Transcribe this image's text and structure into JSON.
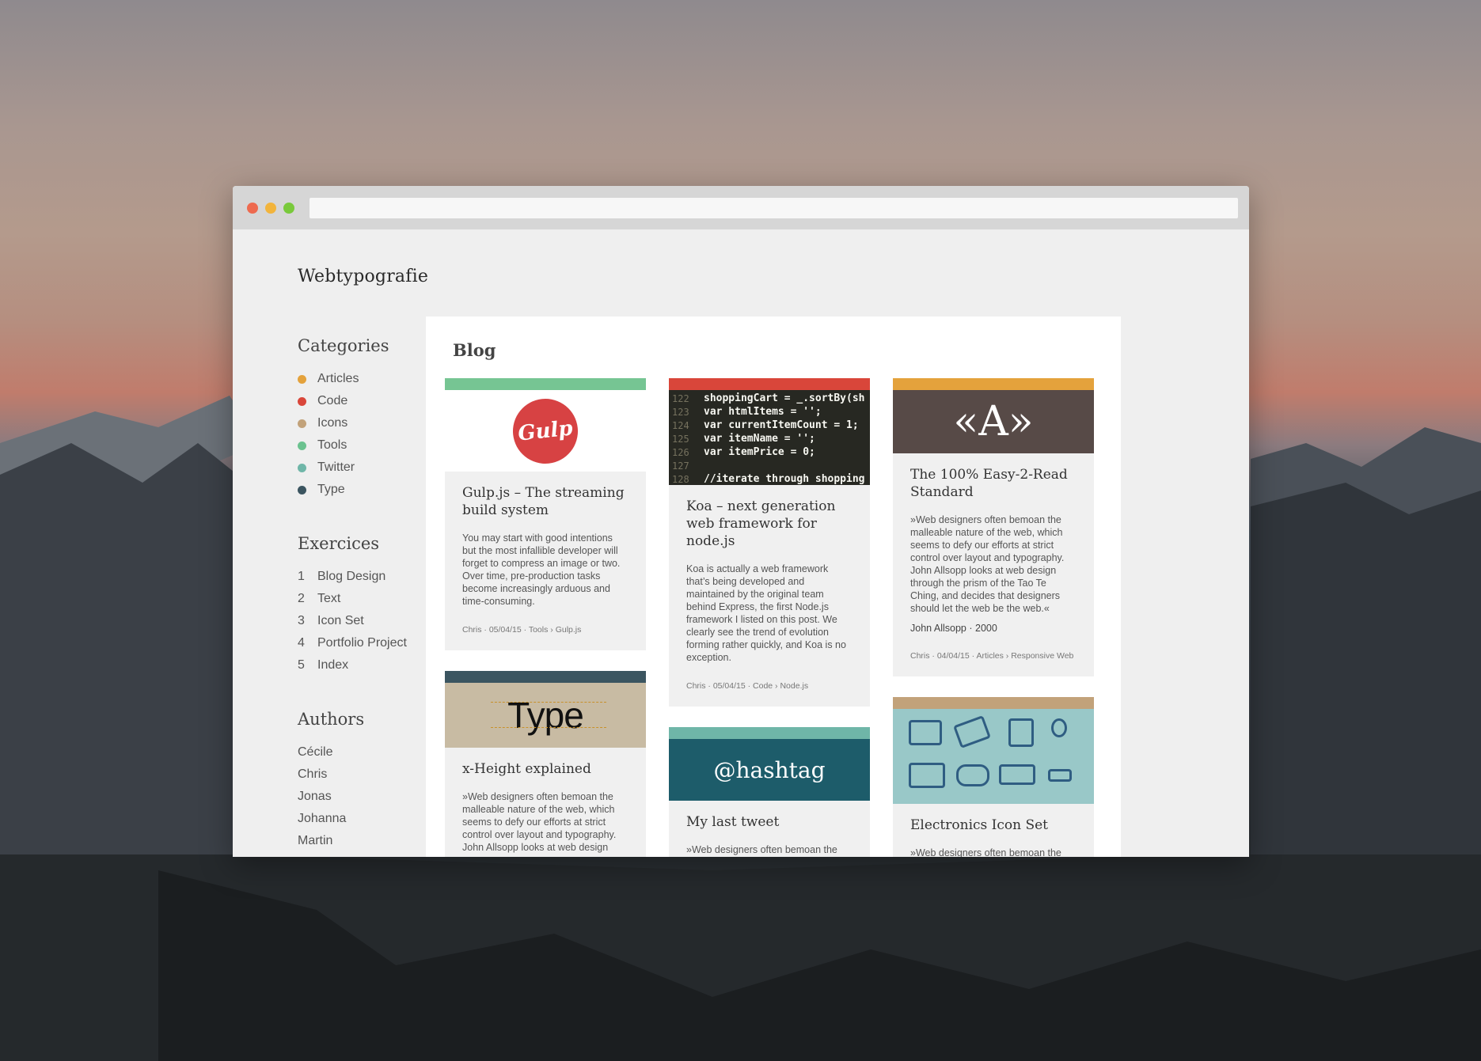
{
  "site": {
    "title": "Webtypografie"
  },
  "sidebar": {
    "categories_heading": "Categories",
    "categories": [
      {
        "label": "Articles",
        "color": "#e4a23c"
      },
      {
        "label": "Code",
        "color": "#d9463a"
      },
      {
        "label": "Icons",
        "color": "#c2a27a"
      },
      {
        "label": "Tools",
        "color": "#6bc28f"
      },
      {
        "label": "Twitter",
        "color": "#6fb6a8"
      },
      {
        "label": "Type",
        "color": "#3b5560"
      }
    ],
    "exercises_heading": "Exercices",
    "exercises": [
      {
        "num": "1",
        "label": "Blog Design"
      },
      {
        "num": "2",
        "label": "Text"
      },
      {
        "num": "3",
        "label": "Icon Set"
      },
      {
        "num": "4",
        "label": "Portfolio Project"
      },
      {
        "num": "5",
        "label": "Index"
      }
    ],
    "authors_heading": "Authors",
    "authors": [
      "Cécile",
      "Chris",
      "Jonas",
      "Johanna",
      "Martin"
    ]
  },
  "blog": {
    "heading": "Blog",
    "cards": {
      "gulp": {
        "stripe_color": "#76c593",
        "image_text": "Gulp",
        "title": "Gulp.js – The streaming build system",
        "text": "You may start with good intentions but the most infallible developer will forget to compress an image or two. Over time, pre-production tasks become increasingly arduous and time-consuming.",
        "meta": "Chris · 05/04/15 · Tools › Gulp.js"
      },
      "koa": {
        "stripe_color": "#d9463a",
        "code": [
          {
            "ln": "122",
            "text": "shoppingCart = _.sortBy(sh"
          },
          {
            "ln": "123",
            "text": "var htmlItems = '';"
          },
          {
            "ln": "124",
            "text": "var currentItemCount = 1;"
          },
          {
            "ln": "125",
            "text": "var itemName = '';"
          },
          {
            "ln": "126",
            "text": "var itemPrice = 0;"
          },
          {
            "ln": "127",
            "text": ""
          },
          {
            "ln": "128",
            "text": "//iterate through shopping"
          }
        ],
        "title": "Koa – next generation web framework for node.js",
        "text": "Koa is actually a web framework that’s being developed and maintained by the original team behind Express, the first Node.js framework I listed on this post. We clearly see the trend of evolution forming rather quickly, and Koa is no exception.",
        "meta": "Chris · 05/04/15 · Code › Node.js"
      },
      "readable": {
        "stripe_color": "#e4a23c",
        "image_text": "«A»",
        "title": "The 100% Easy-2-Read Standard",
        "text": "»Web designers often bemoan the malleable nature of the web, which seems to defy our efforts at strict control over layout and typography. John Allsopp looks at web design through the prism of the Tao Te Ching, and decides that designers should let the web be the web.«",
        "author": "John Allsopp · 2000",
        "meta": "Chris · 04/04/15 · Articles › Responsive Web"
      },
      "xheight": {
        "stripe_color": "#3b5560",
        "image_text": "Type",
        "title": "x-Height explained",
        "text": "»Web designers often bemoan the malleable nature of the web, which seems to defy our efforts at strict control over layout and typography. John Allsopp looks at web design"
      },
      "tweet": {
        "stripe_color": "#6fb6a8",
        "image_text": "@hashtag",
        "title": "My last tweet",
        "text": "»Web designers often bemoan the malleable nature of the web, which seems to defy our efforts at strict control over layout and typography."
      },
      "icons": {
        "stripe_color": "#c2a27a",
        "title": "Electronics Icon Set",
        "text": "»Web designers often bemoan the malleable nature of the web"
      }
    }
  }
}
